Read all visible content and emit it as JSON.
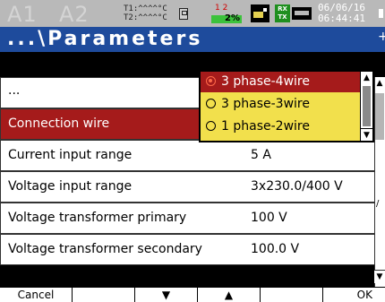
{
  "status_bar": {
    "input_indicators": [
      "A1",
      "A2"
    ],
    "t1_label": "T1:^^^^°C",
    "t2_label": "T2:^^^^°C",
    "load_numbers": "1 2",
    "load_percent": "2%",
    "load_bar_fraction": 0.02,
    "rxtx_label": "RX TX",
    "date": "06/06/16",
    "time": "06:44:41",
    "icons": [
      "sd-card-icon",
      "battery-icon",
      "rxtx-icon",
      "network-icon"
    ]
  },
  "header": {
    "title": "...\\Parameters",
    "plus": "+"
  },
  "rows": [
    {
      "label": "...",
      "value": ""
    },
    {
      "label": "Connection wire",
      "value": "",
      "selected": true
    },
    {
      "label": "Current input range",
      "value": "5 A"
    },
    {
      "label": "Voltage input range",
      "value": "3x230.0/400 V"
    },
    {
      "label": "Voltage transformer primary",
      "value": "100 V"
    },
    {
      "label": "Voltage transformer secondary",
      "value": "100.0 V"
    }
  ],
  "dropdown": {
    "options": [
      "3 phase-4wire",
      "3 phase-3wire",
      "1 phase-2wire"
    ],
    "selected_index": 0
  },
  "softkeys": [
    "Cancel",
    "",
    "▼",
    "▲",
    "",
    "OK"
  ],
  "colors": {
    "status_bg": "#b9b9b9",
    "title_bg": "#1e4b9c",
    "selection": "#a51b1b",
    "dropdown_bg": "#f2e04c"
  }
}
